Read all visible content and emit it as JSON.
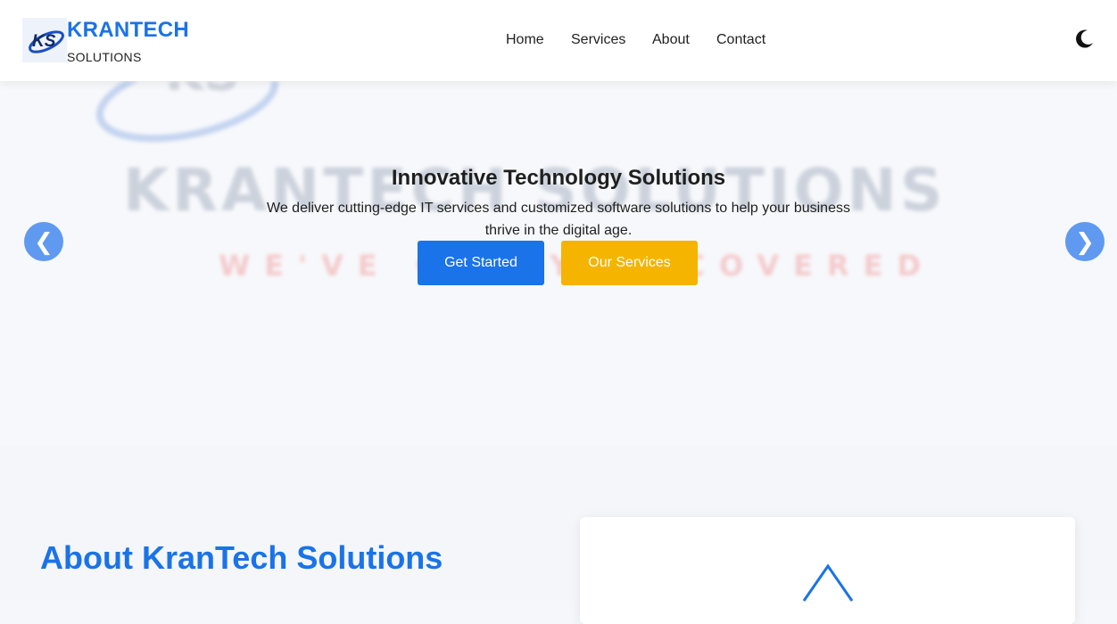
{
  "brand": {
    "name": "KRANTECH",
    "subtitle": "SOLUTIONS",
    "logo_text": "KS",
    "accent": "#1a73e8"
  },
  "nav": {
    "items": [
      {
        "label": "Home"
      },
      {
        "label": "Services"
      },
      {
        "label": "About"
      },
      {
        "label": "Contact"
      }
    ],
    "theme_toggle_icon": "moon-icon"
  },
  "hero": {
    "title": "Innovative Technology Solutions",
    "text": "We deliver cutting-edge IT services and customized software solutions to help your business thrive in the digital age.",
    "primary_button": "Get Started",
    "secondary_button": "Our Services",
    "prev_arrow": "❮",
    "next_arrow": "❯",
    "background_text_1": "KRANTECH SOLUTIONS",
    "background_text_2": "WE'VE GOT YOU COVERED",
    "primary_color": "#1a73e8",
    "secondary_color": "#f4b400"
  },
  "about": {
    "title": "About KranTech Solutions",
    "card_icon": "triangle-icon"
  }
}
